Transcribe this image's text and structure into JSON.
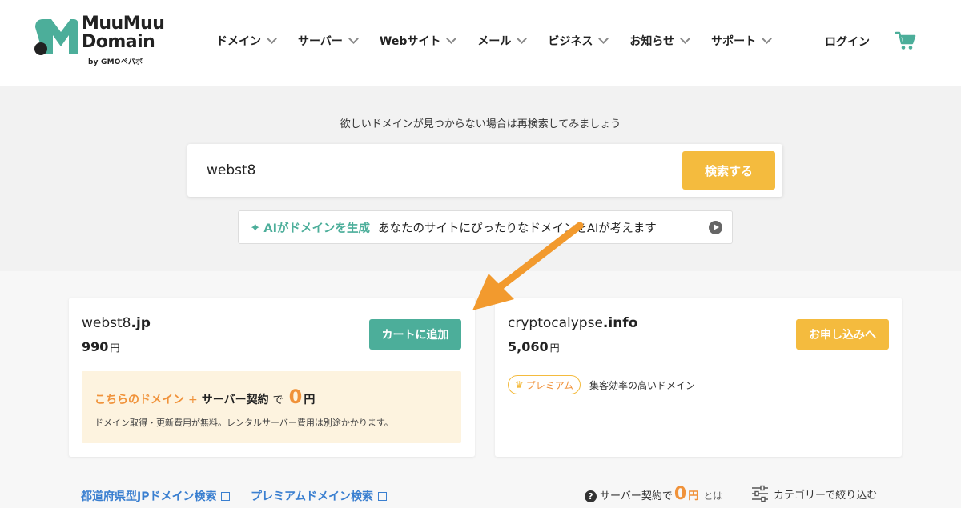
{
  "header": {
    "logo_line1": "MuuMuu",
    "logo_line2": "Domain",
    "logo_by": "by GMOペパボ",
    "nav": [
      {
        "label": "ドメイン"
      },
      {
        "label": "サーバー"
      },
      {
        "label": "Webサイト"
      },
      {
        "label": "メール"
      },
      {
        "label": "ビジネス"
      },
      {
        "label": "お知らせ"
      },
      {
        "label": "サポート"
      }
    ],
    "login": "ログイン",
    "cart_icon": "cart-icon"
  },
  "search": {
    "hint": "欲しいドメインが見つからない場合は再検索してみましょう",
    "value": "webst8",
    "button": "検索する",
    "ai_title": "AIがドメインを生成",
    "ai_desc": "あなたのサイトにぴったりなドメインをAIが考えます"
  },
  "results": [
    {
      "sld": "webst8",
      "tld": ".jp",
      "price": "990",
      "yen": "円",
      "button": "カートに追加",
      "promo": {
        "orange": "こちらのドメイン",
        "plus": "+",
        "bold": "サーバー契約",
        "de": "で",
        "zero": "0",
        "yen": "円",
        "note": "ドメイン取得・更新費用が無料。レンタルサーバー費用は別途かかります。"
      }
    },
    {
      "sld": "cryptocalypse",
      "tld": ".info",
      "price": "5,060",
      "yen": "円",
      "button": "お申し込みへ",
      "badge": "プレミアム",
      "badge_desc": "集客効率の高いドメイン"
    }
  ],
  "footer": {
    "link1": "都道府県型JPドメイン検索",
    "link2": "プレミアムドメイン検索",
    "server_text": "サーバー契約で",
    "server_zero": "0",
    "server_yen": "円",
    "server_toha": "とは",
    "filter": "カテゴリーで絞り込む"
  },
  "colors": {
    "brand_green": "#4cae9a",
    "accent_yellow": "#f4bb3e",
    "orange": "#f0923a",
    "link_blue": "#3a7fd0",
    "annotation_arrow": "#f29a2e"
  }
}
